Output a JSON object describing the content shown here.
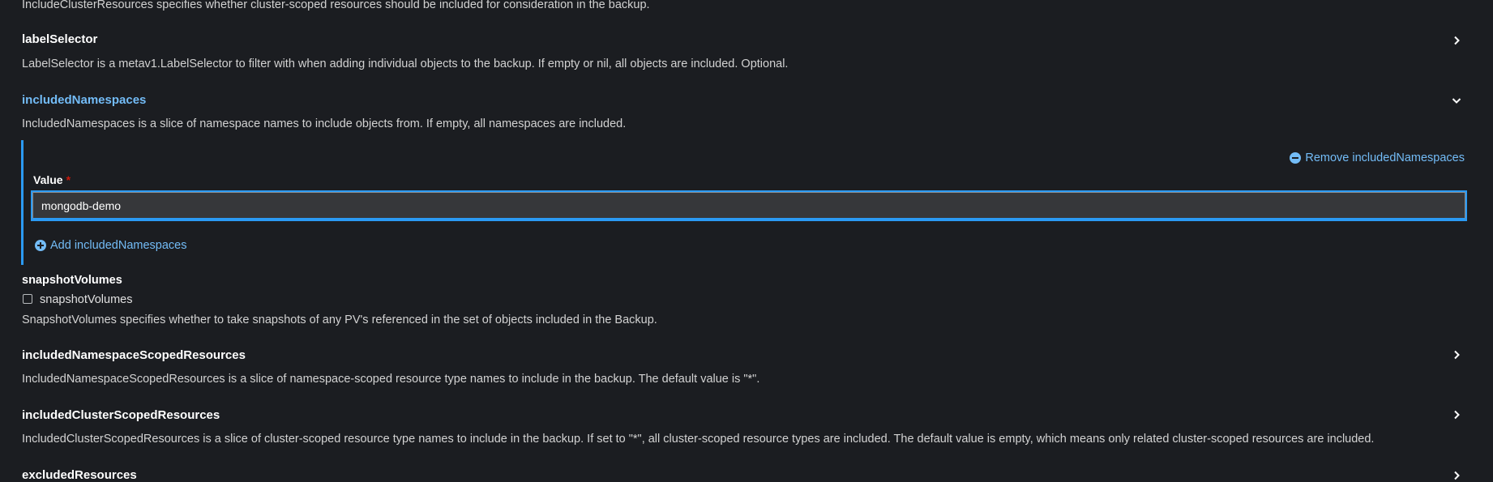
{
  "fields": {
    "include_cluster_resources": {
      "description": "IncludeClusterResources specifies whether cluster-scoped resources should be included for consideration in the backup."
    },
    "label_selector": {
      "title": "labelSelector",
      "description": "LabelSelector is a metav1.LabelSelector to filter with when adding individual objects to the backup. If empty or nil, all objects are included. Optional.",
      "icon": "chevron-right-icon"
    },
    "included_namespaces": {
      "title": "includedNamespaces",
      "description": "IncludedNamespaces is a slice of namespace names to include objects from. If empty, all namespaces are included.",
      "icon": "chevron-down-icon",
      "remove_label": "Remove includedNamespaces",
      "value_label": "Value",
      "required_mark": "*",
      "value": "mongodb-demo",
      "add_label": "Add includedNamespaces"
    },
    "snapshot_volumes": {
      "title": "snapshotVolumes",
      "checkbox_label": "snapshotVolumes",
      "checked": false,
      "description": "SnapshotVolumes specifies whether to take snapshots of any PV's referenced in the set of objects included in the Backup."
    },
    "included_namespace_scoped_resources": {
      "title": "includedNamespaceScopedResources",
      "description": "IncludedNamespaceScopedResources is a slice of namespace-scoped resource type names to include in the backup. The default value is \"*\".",
      "icon": "chevron-right-icon"
    },
    "included_cluster_scoped_resources": {
      "title": "includedClusterScopedResources",
      "description": "IncludedClusterScopedResources is a slice of cluster-scoped resource type names to include in the backup. If set to \"*\", all cluster-scoped resource types are included. The default value is empty, which means only related cluster-scoped resources are included.",
      "icon": "chevron-right-icon"
    },
    "excluded_resources": {
      "title": "excludedResources",
      "icon": "chevron-right-icon"
    }
  },
  "colors": {
    "background": "#1b1d21",
    "accent": "#73bcf7",
    "border_accent": "#2b9af3",
    "required": "#c9190b"
  }
}
